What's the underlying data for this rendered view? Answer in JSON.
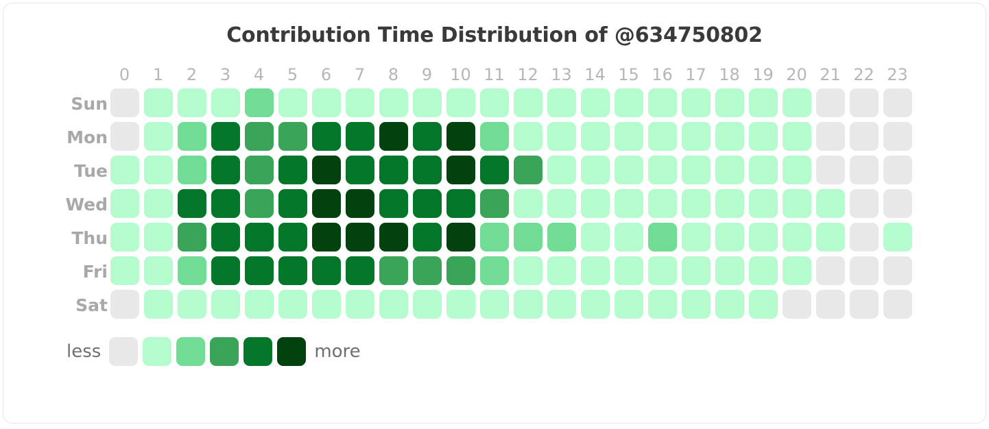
{
  "card": {
    "title": "Contribution Time Distribution of @634750802"
  },
  "legend": {
    "less_label": "less",
    "more_label": "more"
  },
  "chart_data": {
    "type": "heatmap",
    "title": "Contribution Time Distribution of @634750802",
    "xlabel": "",
    "ylabel": "",
    "grid": false,
    "legend_position": "bottom-left",
    "x_tick_labels": [
      "0",
      "1",
      "2",
      "3",
      "4",
      "5",
      "6",
      "7",
      "8",
      "9",
      "10",
      "11",
      "12",
      "13",
      "14",
      "15",
      "16",
      "17",
      "18",
      "19",
      "20",
      "21",
      "22",
      "23"
    ],
    "y_tick_labels": [
      "Sun",
      "Mon",
      "Tue",
      "Wed",
      "Thu",
      "Fri",
      "Sat"
    ],
    "level_colors": [
      "#e8e8e8",
      "#b4fbce",
      "#71dd94",
      "#3aa559",
      "#03762a",
      "#01420f"
    ],
    "levels": [
      0,
      1,
      2,
      3,
      4,
      5
    ],
    "rows": [
      {
        "day": "Sun",
        "values": [
          0,
          1,
          1,
          1,
          2,
          1,
          1,
          1,
          1,
          1,
          1,
          1,
          1,
          1,
          1,
          1,
          1,
          1,
          1,
          1,
          1,
          0,
          0,
          0
        ]
      },
      {
        "day": "Mon",
        "values": [
          0,
          1,
          2,
          4,
          3,
          3,
          4,
          4,
          5,
          4,
          5,
          2,
          1,
          1,
          1,
          1,
          1,
          1,
          1,
          1,
          1,
          0,
          0,
          0
        ]
      },
      {
        "day": "Tue",
        "values": [
          1,
          1,
          2,
          4,
          3,
          4,
          5,
          4,
          4,
          4,
          5,
          4,
          3,
          1,
          1,
          1,
          1,
          1,
          1,
          1,
          1,
          0,
          0,
          0
        ]
      },
      {
        "day": "Wed",
        "values": [
          1,
          1,
          4,
          4,
          3,
          4,
          5,
          5,
          4,
          4,
          4,
          3,
          1,
          1,
          1,
          1,
          1,
          1,
          1,
          1,
          1,
          1,
          0,
          0
        ]
      },
      {
        "day": "Thu",
        "values": [
          1,
          1,
          3,
          4,
          4,
          4,
          5,
          5,
          5,
          4,
          5,
          2,
          2,
          2,
          1,
          1,
          2,
          1,
          1,
          1,
          1,
          1,
          0,
          1
        ]
      },
      {
        "day": "Fri",
        "values": [
          1,
          1,
          2,
          4,
          4,
          4,
          4,
          4,
          3,
          3,
          3,
          2,
          1,
          1,
          1,
          1,
          1,
          1,
          1,
          1,
          1,
          0,
          0,
          0
        ]
      },
      {
        "day": "Sat",
        "values": [
          0,
          1,
          1,
          1,
          1,
          1,
          1,
          1,
          1,
          1,
          1,
          1,
          1,
          1,
          1,
          1,
          1,
          1,
          1,
          1,
          0,
          0,
          0,
          0
        ]
      }
    ]
  }
}
